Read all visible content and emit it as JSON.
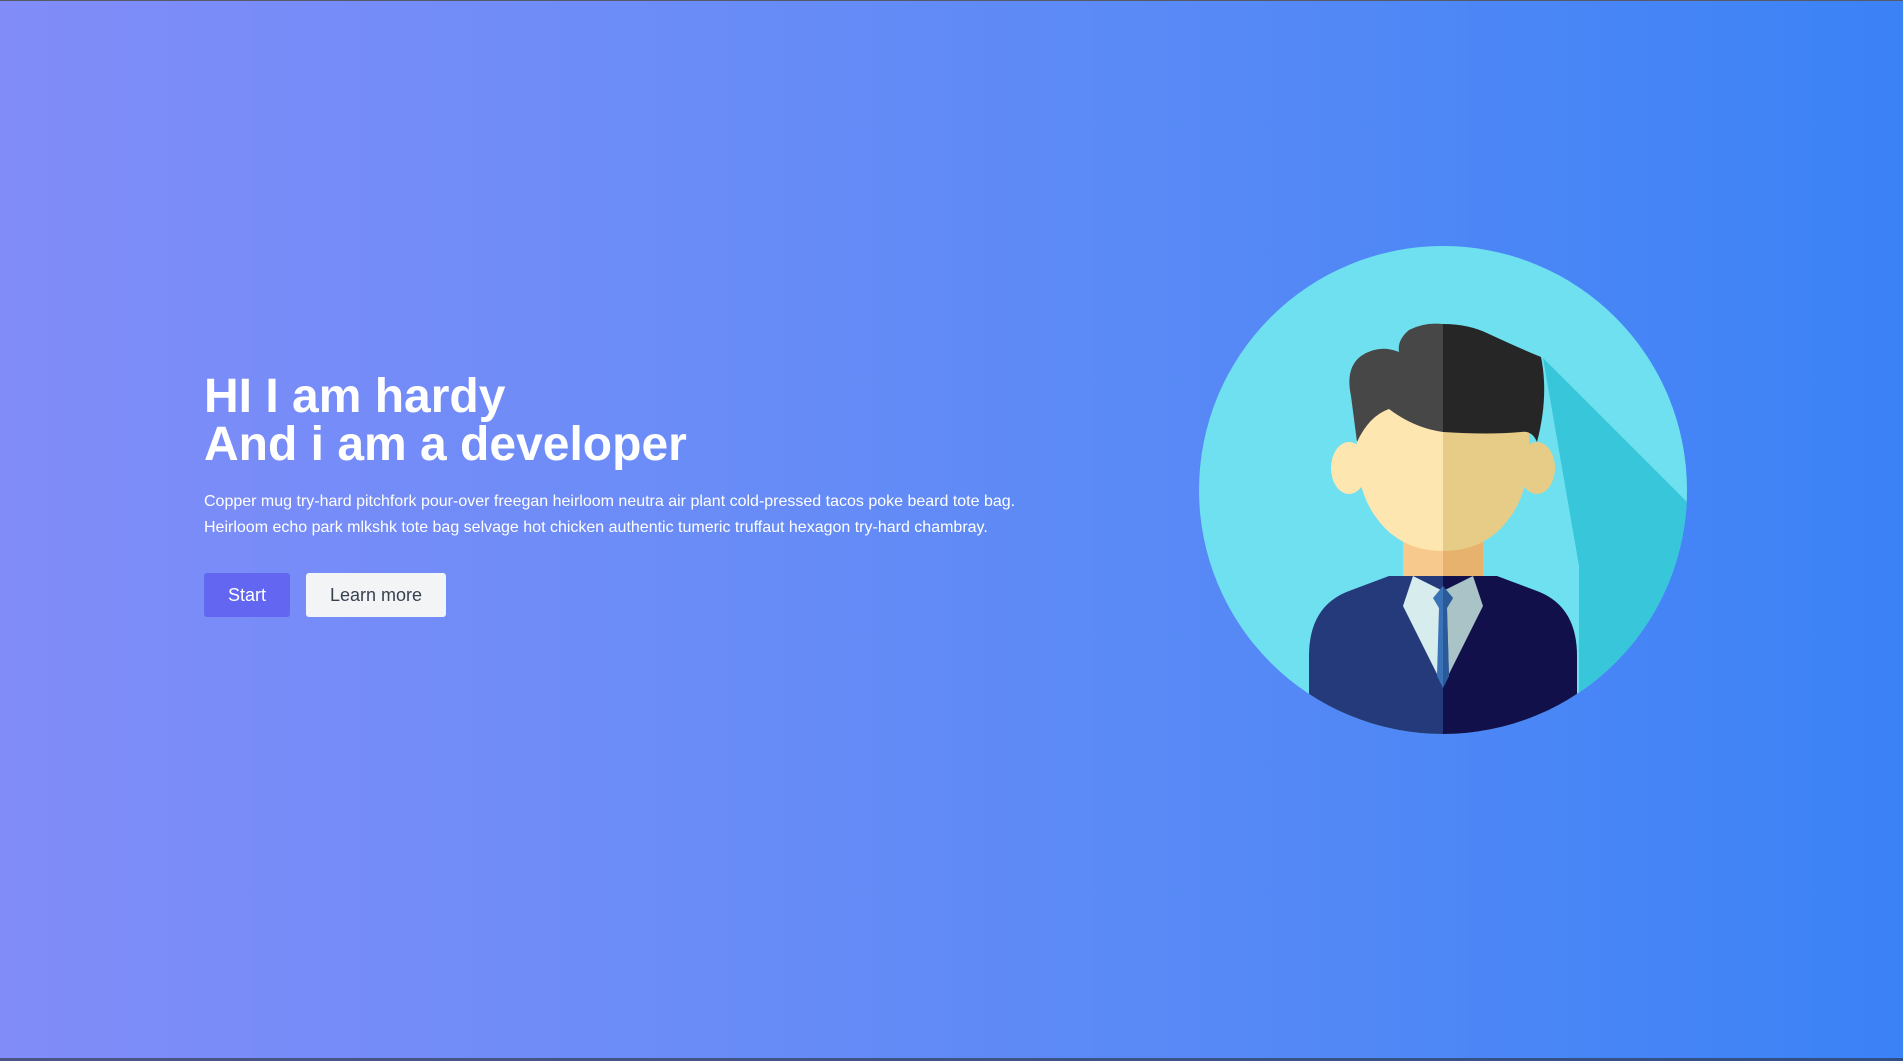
{
  "hero": {
    "title_line1": "HI I am hardy",
    "title_line2": "And i am a developer",
    "description_line1": "Copper mug try-hard pitchfork pour-over freegan heirloom neutra air plant cold-pressed tacos poke beard tote bag.",
    "description_line2": "Heirloom echo park mlkshk tote bag selvage hot chicken authentic tumeric truffaut hexagon try-hard chambray.",
    "primary_button": "Start",
    "secondary_button": "Learn more",
    "illustration_icon": "developer-avatar-icon"
  },
  "colors": {
    "gradient_start": "#818cf8",
    "gradient_end": "#3b82f6",
    "primary_button_bg": "#6366f1",
    "secondary_button_bg": "#f3f4f6",
    "avatar_circle": "#6ee0ef"
  }
}
